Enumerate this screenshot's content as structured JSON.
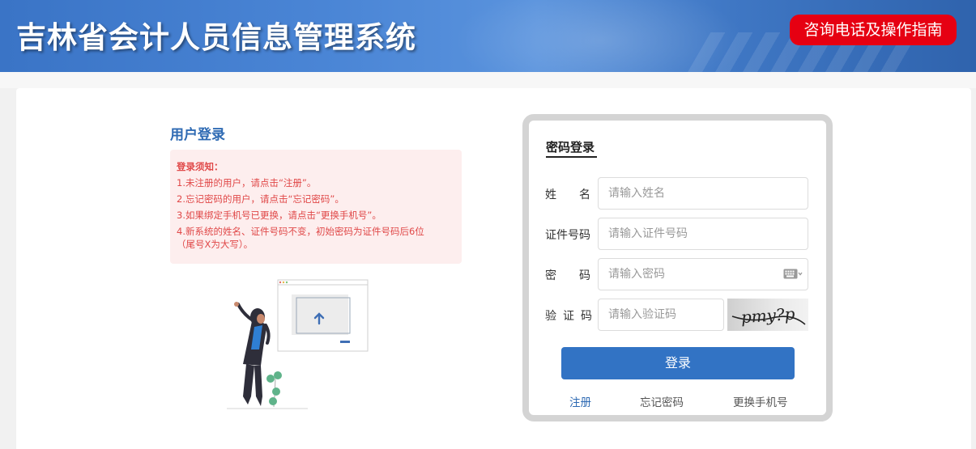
{
  "header": {
    "title": "吉林省会计人员信息管理系统",
    "guide_button": "咨询电话及操作指南"
  },
  "left": {
    "section_title": "用户登录",
    "notice_title": "登录须知：",
    "notice_items": [
      "1.未注册的用户，请点击“注册”。",
      "2.忘记密码的用户，请点击“忘记密码”。",
      "3.如果绑定手机号已更换，请点击“更换手机号”。",
      "4.新系统的姓名、证件号码不变，初始密码为证件号码后6位",
      "（尾号X为大写）。"
    ]
  },
  "login": {
    "tab_label": "密码登录",
    "fields": {
      "name_label": "姓名",
      "name_placeholder": "请输入姓名",
      "id_label": "证件号码",
      "id_placeholder": "请输入证件号码",
      "password_label": "密码",
      "password_placeholder": "请输入密码",
      "captcha_label": "验证码",
      "captcha_placeholder": "请输入验证码",
      "captcha_text": "pmy?p"
    },
    "submit_label": "登录",
    "links": {
      "register": "注册",
      "forgot_password": "忘记密码",
      "change_phone": "更换手机号"
    }
  },
  "colors": {
    "header_blue": "#3a74c6",
    "guide_red": "#e60012",
    "primary_blue": "#3273c4",
    "notice_text": "#e04848"
  }
}
